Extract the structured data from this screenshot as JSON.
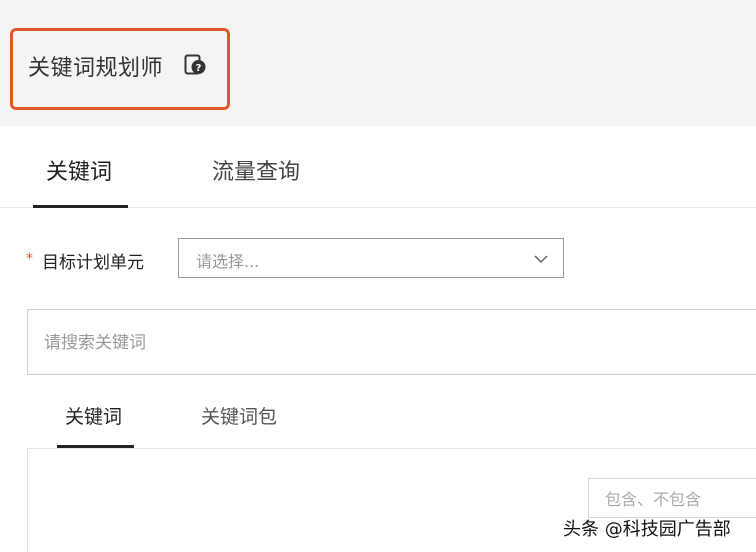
{
  "header": {
    "title": "关键词规划师",
    "help_icon": "help-document-icon",
    "highlight_color": "#e0572b"
  },
  "main_tabs": [
    {
      "label": "关键词",
      "active": true
    },
    {
      "label": "流量查询",
      "active": false
    }
  ],
  "form": {
    "target_unit_label": "目标计划单元",
    "required_mark": "*",
    "select_placeholder": "请选择..."
  },
  "search": {
    "placeholder": "请搜索关键词"
  },
  "sub_tabs": [
    {
      "label": "关键词",
      "active": true
    },
    {
      "label": "关键词包",
      "active": false
    }
  ],
  "filter": {
    "placeholder": "包含、不包含"
  },
  "watermark": "头条 @科技园广告部"
}
